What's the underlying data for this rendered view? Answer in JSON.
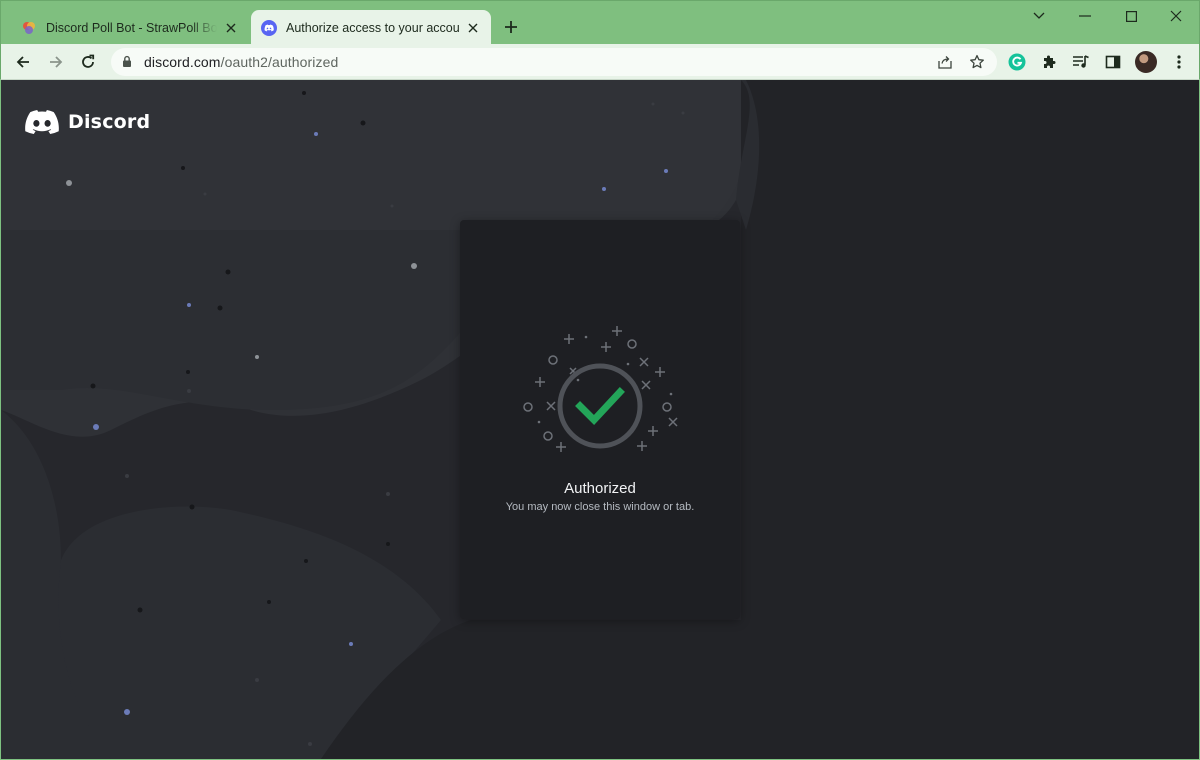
{
  "browser": {
    "tabs": [
      {
        "title": "Discord Poll Bot - StrawPoll Bot fo",
        "active": false,
        "favicon": "strawpoll-favicon"
      },
      {
        "title": "Authorize access to your account",
        "active": true,
        "favicon": "discord-favicon"
      }
    ],
    "address_bar": {
      "domain": "discord.com",
      "path": "/oauth2/authorized"
    },
    "icons": {
      "back": "back-arrow-icon",
      "forward": "forward-arrow-icon",
      "reload": "reload-icon",
      "lock": "lock-icon",
      "share": "share-icon",
      "bookmark": "star-icon",
      "grammarly": "grammarly-icon",
      "extensions": "puzzle-icon",
      "media": "media-queue-icon",
      "side_panel": "side-panel-icon",
      "menu": "kebab-menu-icon"
    },
    "theme_color": "#7fbf7f"
  },
  "page": {
    "brand": "Discord",
    "card": {
      "title": "Authorized",
      "subtitle": "You may now close this window or tab."
    },
    "colors": {
      "background": "#26272c",
      "card": "#1e1f23",
      "check": "#23a559"
    }
  }
}
